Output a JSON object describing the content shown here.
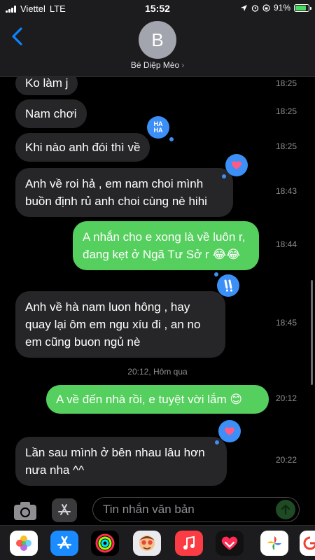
{
  "status_bar": {
    "carrier": "Viettel",
    "network": "LTE",
    "time": "15:52",
    "battery": "91%",
    "battery_level": 0.91
  },
  "header": {
    "avatar_initial": "B",
    "contact_name": "Bé Diệp Mèo",
    "chevron": "›"
  },
  "messages": [
    {
      "text": "Ko làm j",
      "time": "18:25",
      "from": "them"
    },
    {
      "text": "Nam chơi",
      "time": "18:25",
      "from": "them"
    },
    {
      "text": "Khi nào anh đói thì về",
      "time": "18:25",
      "from": "them",
      "reaction": "haha"
    },
    {
      "text": "Anh về roi hả , em nam choi mình buồn định rủ anh choi cùng nè hihi",
      "time": "18:43",
      "from": "them",
      "reaction": "heart"
    },
    {
      "text": "A nhắn cho e xong là về luôn r, đang kẹt ở Ngã Tư Sở r 😂😂",
      "time": "18:44",
      "from": "me",
      "reaction": "emphasis"
    },
    {
      "text": "Anh về hà nam luon hông , hay quay lại ôm em ngu xíu đi , an no em cũng buon ngủ nè",
      "time": "18:45",
      "from": "them"
    },
    {
      "text": "A về đến nhà rồi, e tuyệt vời lắm 😊",
      "time": "20:12",
      "from": "me"
    },
    {
      "text": "Lần sau mình ở bên nhau lâu hơn nưa nha ^^",
      "time": "20:22",
      "from": "them",
      "reaction": "heart"
    }
  ],
  "day_stamp": "20:12, Hôm qua",
  "reactions": {
    "haha_line1": "HA",
    "haha_line2": "HA"
  },
  "input": {
    "placeholder": "Tin nhắn văn bản"
  },
  "colors": {
    "incoming_bubble": "#262628",
    "outgoing_bubble": "#55cf5d",
    "reaction_badge": "#3b8ff6",
    "accent_blue": "#0a84ff"
  },
  "app_drawer": [
    "photos-app",
    "app-store",
    "activity",
    "memoji",
    "music",
    "digital-touch",
    "google-photos",
    "google"
  ]
}
